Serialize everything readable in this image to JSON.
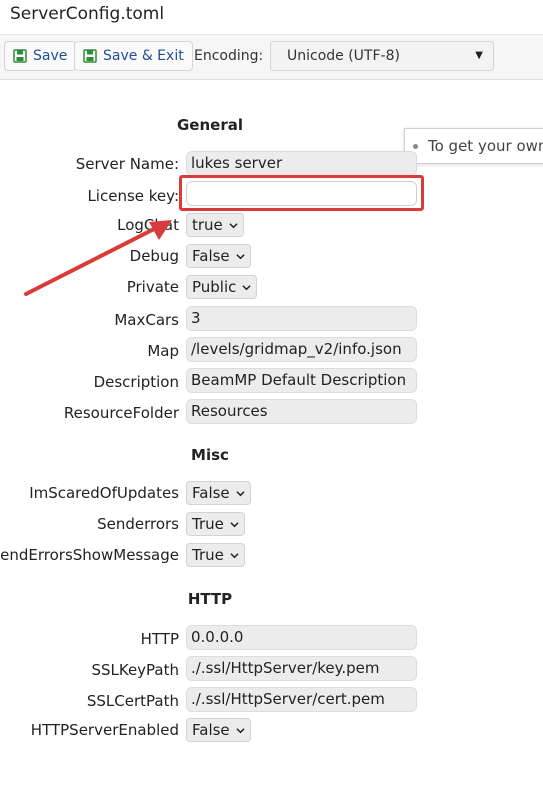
{
  "window": {
    "title": "ServerConfig.toml"
  },
  "toolbar": {
    "save_label": "Save",
    "save_exit_label": "Save & Exit",
    "encoding_label": "Encoding:",
    "encoding_value": "Unicode (UTF-8)"
  },
  "tooltip": {
    "text": "To get your own"
  },
  "sections": {
    "general": "General",
    "misc": "Misc",
    "http": "HTTP"
  },
  "general": {
    "server_name_label": "Server Name:",
    "server_name_value": "lukes server",
    "license_key_label": "License key:",
    "license_key_value": "",
    "logchat_label": "LogChat",
    "logchat_value": "true",
    "debug_label": "Debug",
    "debug_value": "False",
    "private_label": "Private",
    "private_value": "Public",
    "maxcars_label": "MaxCars",
    "maxcars_value": "3",
    "map_label": "Map",
    "map_value": "/levels/gridmap_v2/info.json",
    "description_label": "Description",
    "description_value": "BeamMP Default Description",
    "resource_label": "ResourceFolder",
    "resource_value": "Resources"
  },
  "misc": {
    "scared_label": "ImScaredOfUpdates",
    "scared_value": "False",
    "senderrors_label": "Senderrors",
    "senderrors_value": "True",
    "sendmsg_label": "SendErrorsShowMessage",
    "sendmsg_value": "True"
  },
  "http": {
    "http_label": "HTTP",
    "http_value": "0.0.0.0",
    "sslkey_label": "SSLKeyPath",
    "sslkey_value": "./.ssl/HttpServer/key.pem",
    "sslcert_label": "SSLCertPath",
    "sslcert_value": "./.ssl/HttpServer/cert.pem",
    "enabled_label": "HTTPServerEnabled",
    "enabled_value": "False"
  },
  "colors": {
    "annotation": "#d93a3a",
    "link": "#1f4f9a",
    "save_icon": "#2e8b3a"
  },
  "icons": [
    "save-icon",
    "chevron-down-icon",
    "caret-down-icon",
    "bullet-icon",
    "annotation-arrow"
  ]
}
